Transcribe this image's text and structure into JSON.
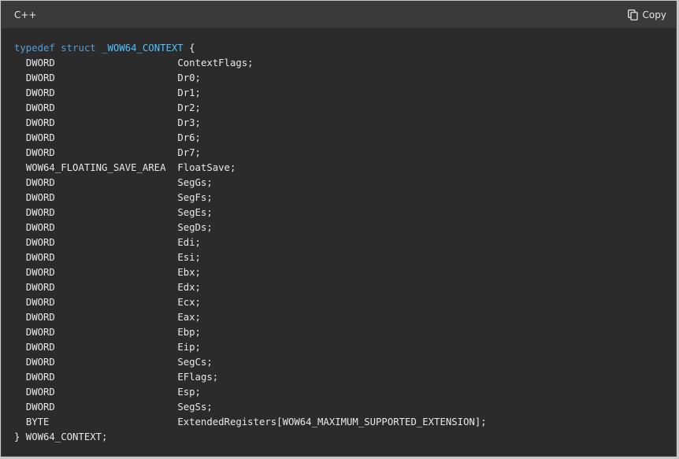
{
  "header": {
    "language": "C++",
    "copy_label": "Copy"
  },
  "code": {
    "open": {
      "keyword1": "typedef",
      "keyword2": "struct",
      "name": "_WOW64_CONTEXT",
      "brace": " {"
    },
    "members": [
      {
        "type": "DWORD",
        "name": "ContextFlags;"
      },
      {
        "type": "DWORD",
        "name": "Dr0;"
      },
      {
        "type": "DWORD",
        "name": "Dr1;"
      },
      {
        "type": "DWORD",
        "name": "Dr2;"
      },
      {
        "type": "DWORD",
        "name": "Dr3;"
      },
      {
        "type": "DWORD",
        "name": "Dr6;"
      },
      {
        "type": "DWORD",
        "name": "Dr7;"
      },
      {
        "type": "WOW64_FLOATING_SAVE_AREA",
        "name": "FloatSave;"
      },
      {
        "type": "DWORD",
        "name": "SegGs;"
      },
      {
        "type": "DWORD",
        "name": "SegFs;"
      },
      {
        "type": "DWORD",
        "name": "SegEs;"
      },
      {
        "type": "DWORD",
        "name": "SegDs;"
      },
      {
        "type": "DWORD",
        "name": "Edi;"
      },
      {
        "type": "DWORD",
        "name": "Esi;"
      },
      {
        "type": "DWORD",
        "name": "Ebx;"
      },
      {
        "type": "DWORD",
        "name": "Edx;"
      },
      {
        "type": "DWORD",
        "name": "Ecx;"
      },
      {
        "type": "DWORD",
        "name": "Eax;"
      },
      {
        "type": "DWORD",
        "name": "Ebp;"
      },
      {
        "type": "DWORD",
        "name": "Eip;"
      },
      {
        "type": "DWORD",
        "name": "SegCs;"
      },
      {
        "type": "DWORD",
        "name": "EFlags;"
      },
      {
        "type": "DWORD",
        "name": "Esp;"
      },
      {
        "type": "DWORD",
        "name": "SegSs;"
      },
      {
        "type": "BYTE",
        "name": "ExtendedRegisters[WOW64_MAXIMUM_SUPPORTED_EXTENSION];"
      }
    ],
    "close": "} WOW64_CONTEXT;"
  }
}
